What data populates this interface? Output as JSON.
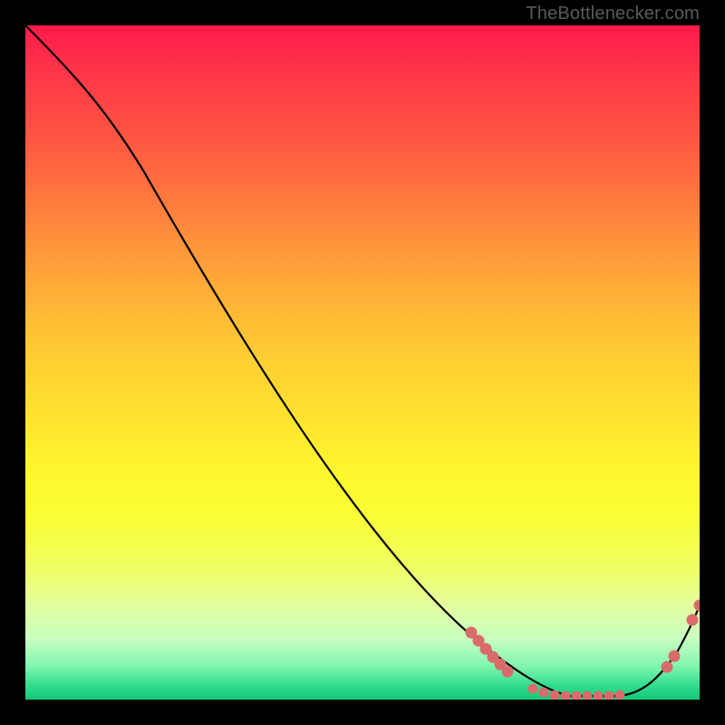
{
  "watermark": "TheBottlenecker.com",
  "chart_data": {
    "type": "line",
    "title": "",
    "xlabel": "",
    "ylabel": "",
    "xlim": [
      0,
      1
    ],
    "ylim": [
      0,
      1
    ],
    "background_gradient": {
      "direction": "vertical",
      "stops": [
        {
          "pos": 0.0,
          "color": "#ff1a4a"
        },
        {
          "pos": 0.5,
          "color": "#ffd834"
        },
        {
          "pos": 0.8,
          "color": "#f4ff60"
        },
        {
          "pos": 1.0,
          "color": "#14c877"
        }
      ]
    },
    "series": [
      {
        "name": "bottleneck-curve",
        "color": "#000000",
        "x": [
          0.0,
          0.05,
          0.1,
          0.15,
          0.2,
          0.25,
          0.3,
          0.35,
          0.4,
          0.45,
          0.5,
          0.55,
          0.6,
          0.65,
          0.7,
          0.75,
          0.8,
          0.83,
          0.86,
          0.9,
          0.93,
          0.96,
          0.98,
          1.0
        ],
        "y": [
          1.0,
          0.95,
          0.88,
          0.79,
          0.71,
          0.63,
          0.55,
          0.47,
          0.39,
          0.31,
          0.24,
          0.18,
          0.13,
          0.09,
          0.05,
          0.02,
          0.005,
          0.003,
          0.003,
          0.01,
          0.03,
          0.07,
          0.11,
          0.14
        ]
      }
    ],
    "highlighted_points": {
      "color": "#d96b6b",
      "x": [
        0.66,
        0.67,
        0.68,
        0.69,
        0.7,
        0.71,
        0.75,
        0.77,
        0.78,
        0.8,
        0.82,
        0.83,
        0.85,
        0.86,
        0.88,
        0.95,
        0.96,
        0.99,
        1.0
      ],
      "y": [
        0.1,
        0.09,
        0.08,
        0.06,
        0.05,
        0.04,
        0.015,
        0.01,
        0.007,
        0.005,
        0.005,
        0.005,
        0.005,
        0.005,
        0.007,
        0.05,
        0.065,
        0.12,
        0.14
      ]
    }
  }
}
